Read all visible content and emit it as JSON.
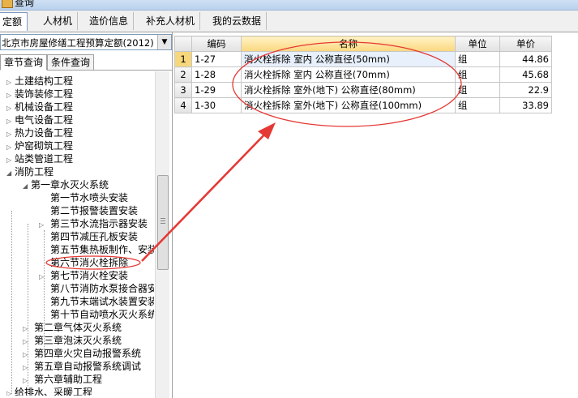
{
  "window": {
    "title": "查询"
  },
  "tabs": [
    {
      "label": "定额"
    },
    {
      "label": "人材机"
    },
    {
      "label": "造价信息"
    },
    {
      "label": "补充人材机"
    },
    {
      "label": "我的云数据"
    }
  ],
  "left_panel": {
    "quota_library": "北京市房屋修缮工程预算定额(2012)",
    "subtabs": [
      {
        "label": "章节查询"
      },
      {
        "label": "条件查询"
      }
    ],
    "tree": [
      {
        "label": "土建结构工程"
      },
      {
        "label": "装饰装修工程"
      },
      {
        "label": "机械设备工程"
      },
      {
        "label": "电气设备工程"
      },
      {
        "label": "热力设备工程"
      },
      {
        "label": "炉窑砌筑工程"
      },
      {
        "label": "站类管道工程"
      },
      {
        "label": "消防工程"
      },
      {
        "label": "第一章水灭火系统"
      },
      {
        "label": "第一节水喷头安装"
      },
      {
        "label": "第二节报警装置安装"
      },
      {
        "label": "第三节水流指示器安装"
      },
      {
        "label": "第四节减压孔板安装"
      },
      {
        "label": "第五节集热板制作、安装"
      },
      {
        "label": "第六节消火栓拆除"
      },
      {
        "label": "第七节消火栓安装"
      },
      {
        "label": "第八节消防水泵接合器安装"
      },
      {
        "label": "第九节末端试水装置安装"
      },
      {
        "label": "第十节自动喷水灭火系统"
      },
      {
        "label": "第二章气体灭火系统"
      },
      {
        "label": "第三章泡沫灭火系统"
      },
      {
        "label": "第四章火灾自动报警系统"
      },
      {
        "label": "第五章自动报警系统调试"
      },
      {
        "label": "第六章辅助工程"
      },
      {
        "label": "给排水、采暖工程"
      }
    ]
  },
  "grid": {
    "columns": [
      "",
      "编码",
      "名称",
      "单位",
      "单价"
    ],
    "rows": [
      {
        "idx": "1",
        "code": "1-27",
        "name": "消火栓拆除 室内 公称直径(50mm)",
        "unit": "组",
        "price": "44.86"
      },
      {
        "idx": "2",
        "code": "1-28",
        "name": "消火栓拆除 室内 公称直径(70mm)",
        "unit": "组",
        "price": "45.68"
      },
      {
        "idx": "3",
        "code": "1-29",
        "name": "消火栓拆除 室外(地下) 公称直径(80mm)",
        "unit": "组",
        "price": "22.9"
      },
      {
        "idx": "4",
        "code": "1-30",
        "name": "消火栓拆除 室外(地下) 公称直径(100mm)",
        "unit": "组",
        "price": "33.89"
      }
    ]
  },
  "annotation": {
    "color": "#e53935"
  }
}
